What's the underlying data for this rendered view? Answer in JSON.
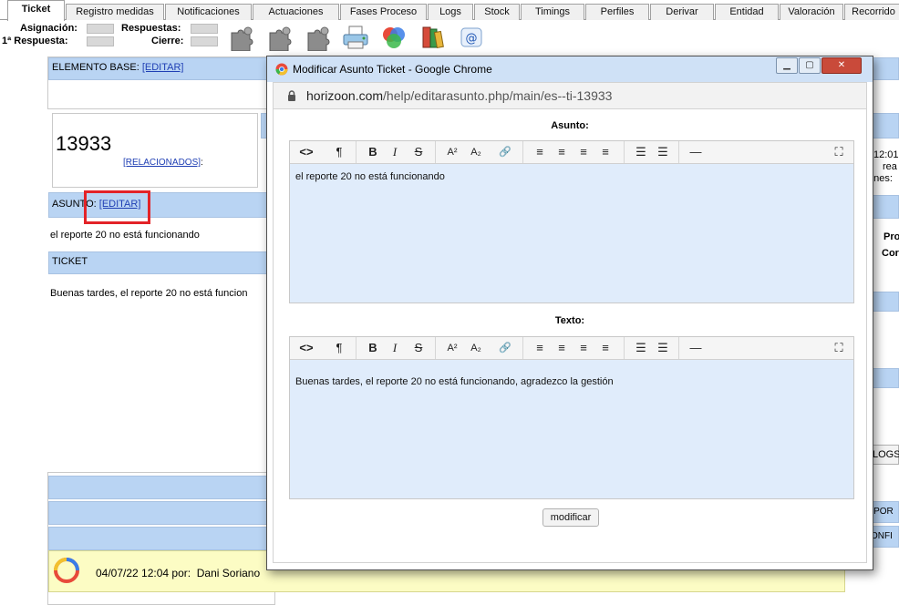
{
  "tabs": [
    "Ticket",
    "Registro medidas",
    "Notificaciones",
    "Actuaciones",
    "Fases Proceso",
    "Logs",
    "Stock",
    "Timings",
    "Perfiles",
    "Derivar",
    "Entidad",
    "Valoración",
    "Recorrido"
  ],
  "header": {
    "asignacion_label": "Asignación:",
    "respuestas_label": "Respuestas:",
    "primera_respuesta_label": "1ª Respuesta:",
    "cierre_label": "Cierre:"
  },
  "toolbar_icons": [
    "puzzle-icon",
    "puzzle-icon",
    "puzzle-icon",
    "printer-icon",
    "colors-icon",
    "books-icon",
    "email-icon"
  ],
  "background": {
    "elemento_base_label": "ELEMENTO BASE:",
    "editar_link": "[EDITAR]",
    "ticket_number": "13933",
    "relacionados_link": "[RELACIONADOS]",
    "relacionados_colon": ":",
    "asunto_label": "ASUNTO:",
    "asunto_editar_link": "[EDITAR]",
    "asunto_text": "el reporte 20 no está funcionando",
    "ticket_label": "TICKET",
    "ticket_text": "Buenas tardes, el reporte 20 no está funcion",
    "right_time": "12:01",
    "right_rea": "rea",
    "right_ones": "ones:",
    "right_pro": "Pro",
    "right_cor": "Cor",
    "right_logs": "LOGS",
    "right_por": ") POR",
    "right_onfi": "ONFI",
    "comment_date": "04/07/22 12:04 por:",
    "comment_author": "Dani Soriano"
  },
  "popup": {
    "title": "Modificar Asunto Ticket - Google Chrome",
    "url_host": "horizoon.com",
    "url_path": "/help/editarasunto.php/main/es--ti-13933",
    "asunto_label": "Asunto:",
    "asunto_value": "el reporte 20 no está funcionando",
    "texto_label": "Texto:",
    "texto_value": "Buenas tardes, el reporte 20 no está funcionando, agradezco la gestión",
    "submit_label": "modificar"
  },
  "editor_toolbar": {
    "code": "<>",
    "paragraph": "¶",
    "bold": "B",
    "italic": "I",
    "strike": "S",
    "superscript": "A²",
    "subscript": "A₂",
    "link": "🔗",
    "align_left": "≡",
    "align_center": "≡",
    "align_right": "≡",
    "justify": "≡",
    "bullets": "☰",
    "numbers": "☰",
    "hr": "—",
    "fullscreen": "⛶"
  }
}
